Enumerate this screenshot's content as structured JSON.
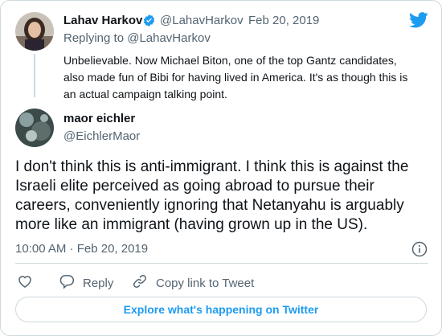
{
  "quoted_tweet": {
    "name": "Lahav Harkov",
    "handle": "@LahavHarkov",
    "separator": "·",
    "date": "Feb 20, 2019",
    "replying_to": "Replying to @LahavHarkov",
    "text_lines": [
      "Unbelievable. Now Michael Biton, one of the top Gantz candidates,",
      "also made fun of Bibi for having lived in America. It's as though this is",
      "an actual campaign talking point."
    ]
  },
  "main_tweet": {
    "name": "maor eichler",
    "handle": "@EichlerMaor",
    "text_lines": [
      "I don't think this is anti-immigrant. I think this is against the",
      "Israeli elite perceived as going abroad to pursue their",
      "careers, conveniently ignoring that Netanyahu is arguably",
      "more like an immigrant (having grown up in the US)."
    ],
    "timestamp": "10:00 AM · Feb 20, 2019"
  },
  "actions": {
    "reply_label": "Reply",
    "copy_link_label": "Copy link to Tweet"
  },
  "explore_label": "Explore what's happening on Twitter",
  "colors": {
    "accent": "#1d9bf0",
    "muted": "#536471",
    "border": "#cfd9de"
  },
  "icons": [
    "verified-badge-icon",
    "twitter-bird-icon",
    "info-icon",
    "heart-icon",
    "reply-icon",
    "link-icon"
  ]
}
